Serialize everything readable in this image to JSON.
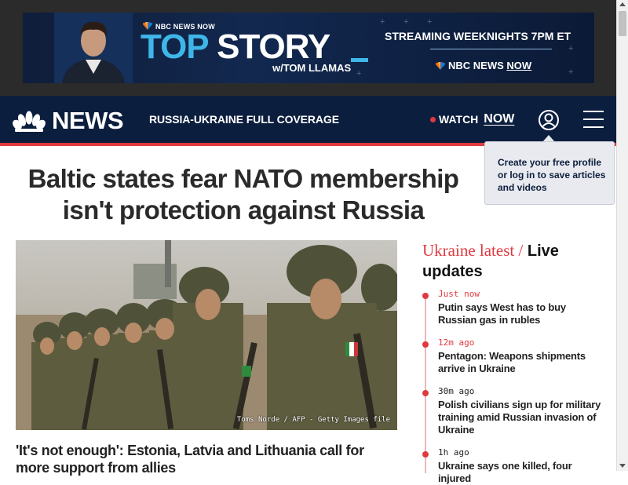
{
  "ad": {
    "eyebrow": "NBC NEWS NOW",
    "headline_top": "TOP",
    "headline_story": "STORY",
    "with_host": "w/TOM LLAMAS",
    "streaming": "STREAMING WEEKNIGHTS 7PM ET",
    "brand": "NBC NEWS",
    "brand_now": "NOW"
  },
  "nav": {
    "logo": "NEWS",
    "coverage": "RUSSIA-UKRAINE FULL COVERAGE",
    "watch": "WATCH",
    "now": "NOW"
  },
  "tooltip": {
    "text": "Create your free profile or log in to save articles and videos"
  },
  "article": {
    "headline": "Baltic states fear NATO membership isn't protection against Russia",
    "credit": "Toms Norde / AFP - Getty Images file",
    "subheadline": "'It's not enough': Estonia, Latvia and Lithuania call for more support from allies"
  },
  "live": {
    "title_red": "Ukraine latest /",
    "title_dark": "Live updates",
    "items": [
      {
        "time": "Just now",
        "text": "Putin says West has to buy Russian gas in rubles"
      },
      {
        "time": "12m ago",
        "text": "Pentagon: Weapons shipments arrive in Ukraine"
      },
      {
        "time": "30m ago",
        "text": "Polish civilians sign up for military training amid Russian invasion of Ukraine"
      },
      {
        "time": "1h ago",
        "text": "Ukraine says one killed, four injured"
      }
    ]
  },
  "colors": {
    "navy": "#0c1e3e",
    "accent_red": "#e0393e",
    "ad_blue": "#3fb6e8"
  }
}
